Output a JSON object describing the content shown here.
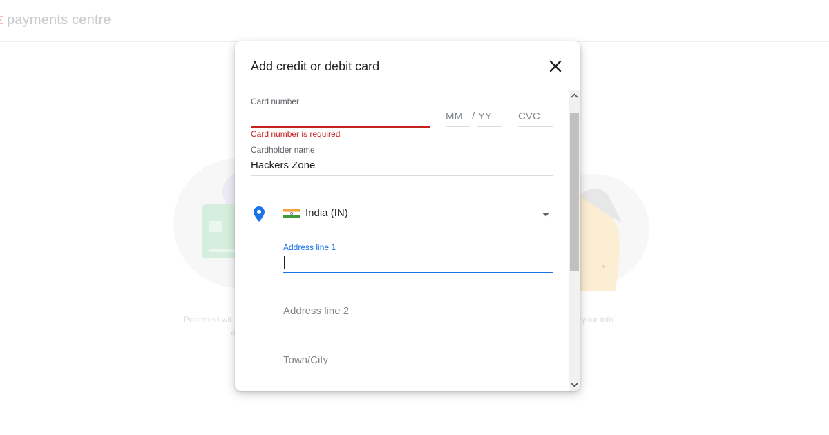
{
  "background": {
    "app_title": "payments centre",
    "caption_left_line1": "Protected wit",
    "caption_left_line2": "a",
    "caption_right": "your info"
  },
  "dialog": {
    "title": "Add credit or debit card",
    "close_icon": "close-icon",
    "card_number": {
      "label": "Card number",
      "value": "",
      "error": "Card number is required",
      "error_color": "#c5221f"
    },
    "expiry": {
      "mm_placeholder": "MM",
      "separator": "/",
      "yy_placeholder": "YY"
    },
    "cvc_placeholder": "CVC",
    "cardholder": {
      "label": "Cardholder name",
      "value": "Hackers Zone"
    },
    "country": {
      "icon": "location-pin-icon",
      "flag": "india-flag-icon",
      "value": "India (IN)"
    },
    "address_line_1": {
      "label": "Address line 1",
      "value": "",
      "focus_color": "#1a73e8"
    },
    "address_line_2": {
      "placeholder": "Address line 2"
    },
    "town_city": {
      "placeholder": "Town/City"
    }
  }
}
